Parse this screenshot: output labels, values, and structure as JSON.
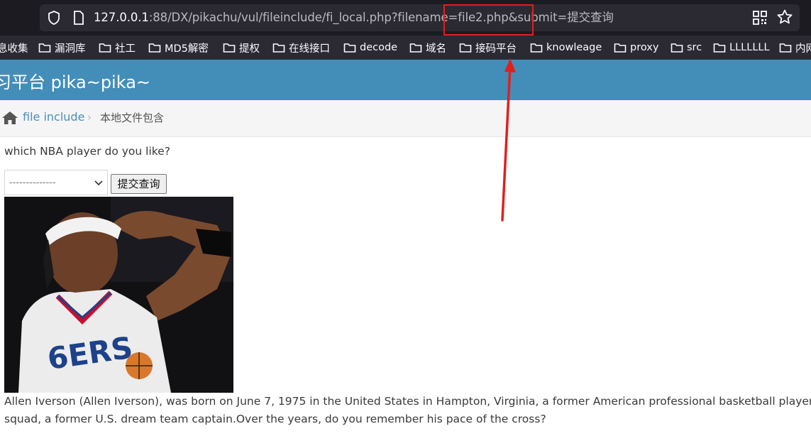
{
  "browser": {
    "url_host": "127.0.0.1",
    "url_rest": ":88/DX/pikachu/vul/fileinclude/fi_local.php?filename=file2.php&submit=提交查询",
    "icons": [
      "shield-icon",
      "page-icon",
      "qr-code-icon",
      "star-icon"
    ]
  },
  "bookmarks": [
    "息收集",
    "漏洞库",
    "社工",
    "MD5解密",
    "提权",
    "在线接口",
    "decode",
    "域名",
    "接码平台",
    "knowleage",
    "proxy",
    "src",
    "LLLLLLL",
    "内网"
  ],
  "header": {
    "title": "习平台 pika~pika~",
    "background_color": "#438eb9"
  },
  "breadcrumb": {
    "home_icon": "home-icon",
    "link": "file include",
    "separator": "›",
    "current": "本地文件包含"
  },
  "main": {
    "question": "which NBA player do you like?",
    "select_value": "--------------",
    "submit_label": "提交查询",
    "description": "Allen Iverson (Allen Iverson), was born on June 7, 1975 in the United States in Hampton, Virginia, a former American professional basketball player, the squad, a former U.S. dream team captain.Over the years, do you remember his pace of the cross?"
  },
  "annotation": {
    "color": "#e0201f"
  }
}
